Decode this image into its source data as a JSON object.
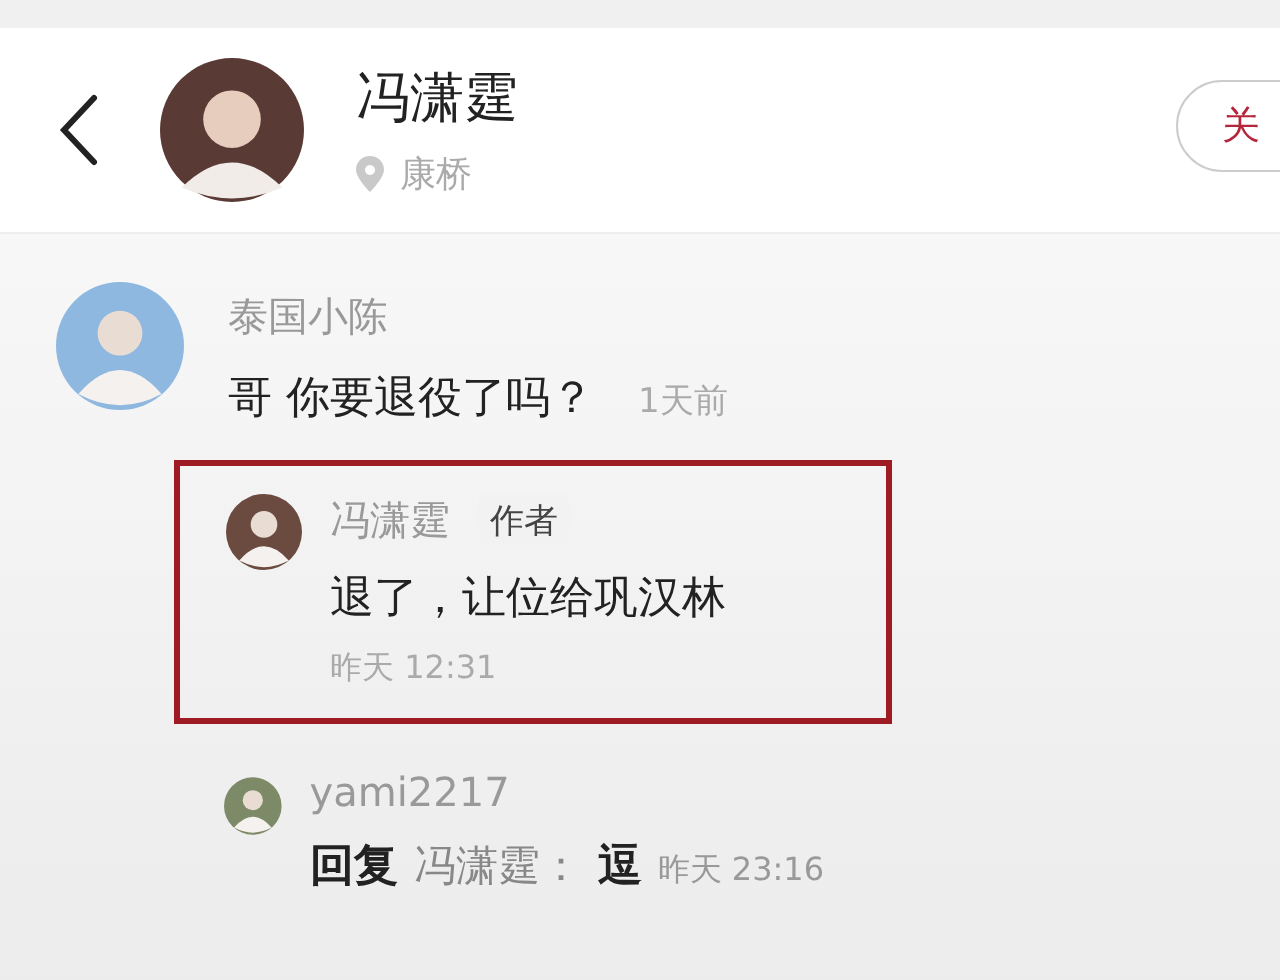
{
  "header": {
    "title": "冯潇霆",
    "location": "康桥",
    "follow_button": "关"
  },
  "comments": [
    {
      "author": "泰国小陈",
      "text": "哥 你要退役了吗？",
      "time": "1天前",
      "replies": [
        {
          "author": "冯潇霆",
          "badge": "作者",
          "text": "退了，让位给巩汉林",
          "time": "昨天 12:31",
          "highlighted": true
        },
        {
          "author": "yami2217",
          "reply_prefix": "回复",
          "reply_to": "冯潇霆：",
          "text": "逗",
          "time": "昨天 23:16",
          "highlighted": false
        }
      ]
    }
  ]
}
